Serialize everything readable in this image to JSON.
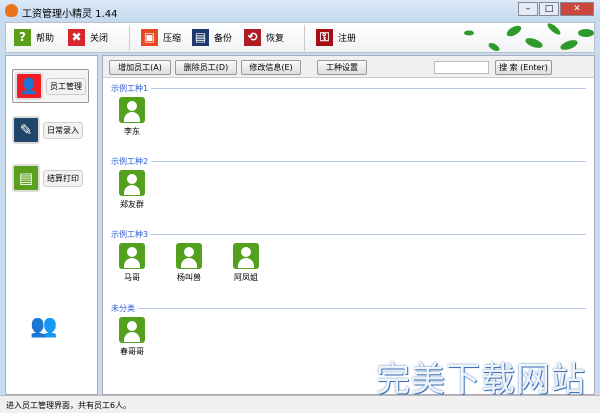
{
  "window": {
    "title": "工资管理小精灵 1.44"
  },
  "toolbar": [
    {
      "label": "帮助",
      "icon": "help-icon",
      "glyph": "?",
      "color": "#5a9e1a"
    },
    {
      "label": "关闭",
      "icon": "close-icon",
      "glyph": "✖",
      "color": "#d9262c"
    },
    {
      "label": "压缩",
      "icon": "compress-icon",
      "glyph": "▣",
      "color": "#e8481f"
    },
    {
      "label": "备份",
      "icon": "save-icon",
      "glyph": "▤",
      "color": "#1e3a6c"
    },
    {
      "label": "恢复",
      "icon": "restore-icon",
      "glyph": "⟲",
      "color": "#b01c24"
    },
    {
      "label": "注册",
      "icon": "key-icon",
      "glyph": "⚿",
      "color": "#a50f15"
    }
  ],
  "sidebar": [
    {
      "label": "员工管理",
      "glyph": "👤",
      "color": "#f01e24"
    },
    {
      "label": "日常录入",
      "glyph": "✎",
      "color": "#1f4668"
    },
    {
      "label": "结算打印",
      "glyph": "▤",
      "color": "#5aa01c"
    }
  ],
  "actions": {
    "add": "增加员工(A)",
    "delete": "删除员工(D)",
    "edit": "修改信息(E)",
    "types": "工种设置",
    "search_value": "",
    "search": "搜 索 (Enter)"
  },
  "groups": [
    {
      "name": "示例工种1",
      "employees": [
        "李东"
      ]
    },
    {
      "name": "示例工种2",
      "employees": [
        "郑友群"
      ]
    },
    {
      "name": "示例工种3",
      "employees": [
        "马哥",
        "杨叫兽",
        "阿凤姐"
      ]
    },
    {
      "name": "未分类",
      "employees": [
        "春哥哥"
      ]
    }
  ],
  "status": "进入员工管理界面，共有员工6人。",
  "watermark": "完美下载网站"
}
